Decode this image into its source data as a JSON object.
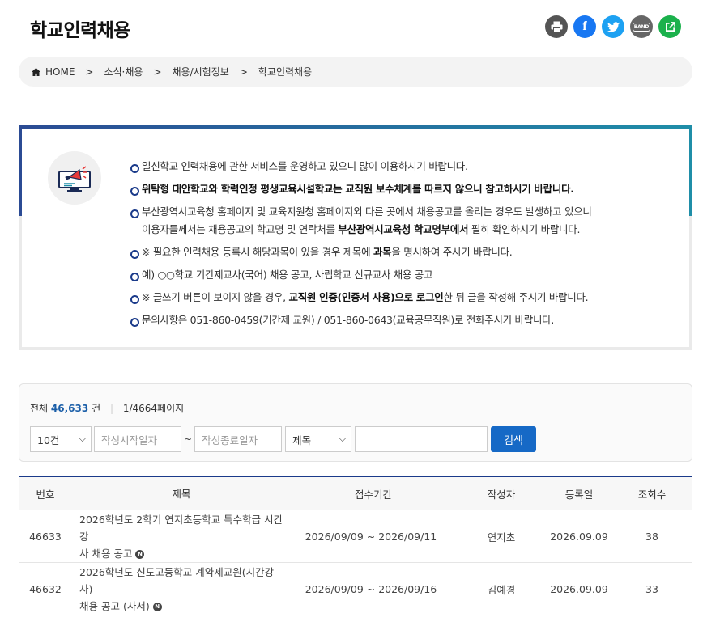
{
  "page": {
    "title": "학교인력채용"
  },
  "share": {
    "print_icon": "printer-icon",
    "facebook_label": "f",
    "band_label": "BAND"
  },
  "breadcrumb": [
    {
      "label": "HOME"
    },
    {
      "label": "소식·채용"
    },
    {
      "label": "채용/시험정보"
    },
    {
      "label": "학교인력채용"
    }
  ],
  "notice": {
    "items": [
      {
        "text": "일신학교 인력채용에 관한 서비스를 운영하고 있으니 많이 이용하시기 바랍니다."
      },
      {
        "text": "위탁형 대안학교와 학력인정 평생교육시설학교는 교직원 보수체계를 따르지 않으니 참고하시기 바랍니다."
      },
      {
        "line1": "부산광역시교육청 홈페이지 및 교육지원청 홈페이지외 다른 곳에서 채용공고를 올리는 경우도 발생하고 있으니",
        "line2_pre": "이용자들께서는 채용공고의 학교명 및 연락처를 ",
        "line2_bold": "부산광역시교육청 학교명부에서",
        "line2_post": " 필히 확인하시기 바랍니다."
      },
      {
        "pre": "※ 필요한 인력채용 등록시 해당과목이 있을 경우 제목에 ",
        "bold": "과목",
        "post": "을 명시하여 주시기 바랍니다."
      },
      {
        "text": "예) ○○학교 기간제교사(국어) 채용 공고, 사립학교 신규교사 채용 공고"
      },
      {
        "pre": "※ 글쓰기 버튼이 보이지 않을 경우, ",
        "bold": "교직원 인증(인증서 사용)으로 로그인",
        "post": "한 뒤 글을 작성해 주시기 바랍니다."
      },
      {
        "text": "문의사항은 051-860-0459(기간제 교원) / 051-860-0643(교육공무직원)로 전화주시기 바랍니다."
      }
    ]
  },
  "search": {
    "total_label": "전체",
    "total_count": "46,633",
    "total_unit": "건",
    "page_info": "1/4664페이지",
    "page_size": "10건",
    "start_date_placeholder": "작성시작일자",
    "tilde": "~",
    "end_date_placeholder": "작성종료일자",
    "field": "제목",
    "keyword": "",
    "button_label": "검색"
  },
  "table": {
    "headers": {
      "no": "번호",
      "title": "제목",
      "period": "접수기간",
      "writer": "작성자",
      "date": "등록일",
      "views": "조회수"
    },
    "rows": [
      {
        "no": "46633",
        "title1": "2026학년도 2학기 연지초등학교 특수학급 시간강",
        "title2": "사 채용 공고",
        "badge": "N",
        "period": "2026/09/09 ~ 2026/09/11",
        "writer": "연지초",
        "date": "2026.09.09",
        "views": "38"
      },
      {
        "no": "46632",
        "title1": "2026학년도 신도고등학교 계약제교원(시간강사)",
        "title2": "채용 공고 (사서)",
        "badge": "N",
        "period": "2026/09/09 ~ 2026/09/16",
        "writer": "김예경",
        "date": "2026.09.09",
        "views": "33"
      }
    ]
  }
}
